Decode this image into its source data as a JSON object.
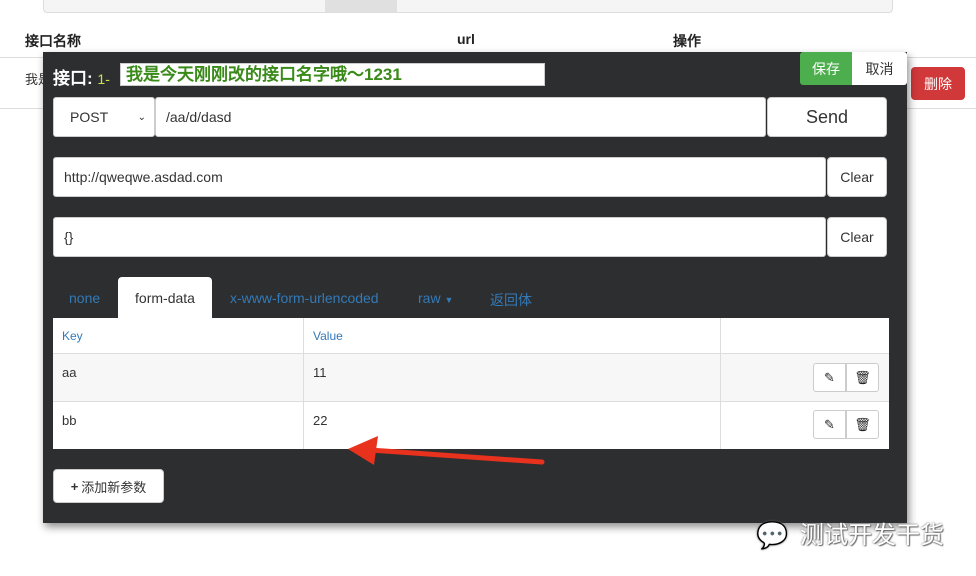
{
  "background": {
    "headers": [
      "接口名称",
      "url",
      "操作"
    ],
    "row_name": "我是",
    "delete_label": "删除"
  },
  "dialog": {
    "title_label": "接口:",
    "id_prefix": "1-",
    "name_value": "我是今天刚刚改的接口名字哦～1231",
    "save_label": "保存",
    "cancel_label": "取消",
    "method": "POST",
    "path": "/aa/d/dasd",
    "send_label": "Send",
    "host": "http://qweqwe.asdad.com",
    "clear_label": "Clear",
    "headers_value": "{}",
    "tabs": [
      "none",
      "form-data",
      "x-www-form-urlencoded",
      "raw",
      "返回体"
    ],
    "active_tab": "form-data",
    "table": {
      "columns": [
        "Key",
        "Value"
      ],
      "rows": [
        {
          "key": "aa",
          "value": "11"
        },
        {
          "key": "bb",
          "value": "22"
        }
      ]
    },
    "add_param_label": "添加新参数"
  },
  "watermark": "测试开发干货",
  "colors": {
    "save": "#4cae4c",
    "delete": "#d0383a",
    "panel": "#2d2e30",
    "name_text": "#3a8a1a",
    "arrow": "#e8321e"
  }
}
